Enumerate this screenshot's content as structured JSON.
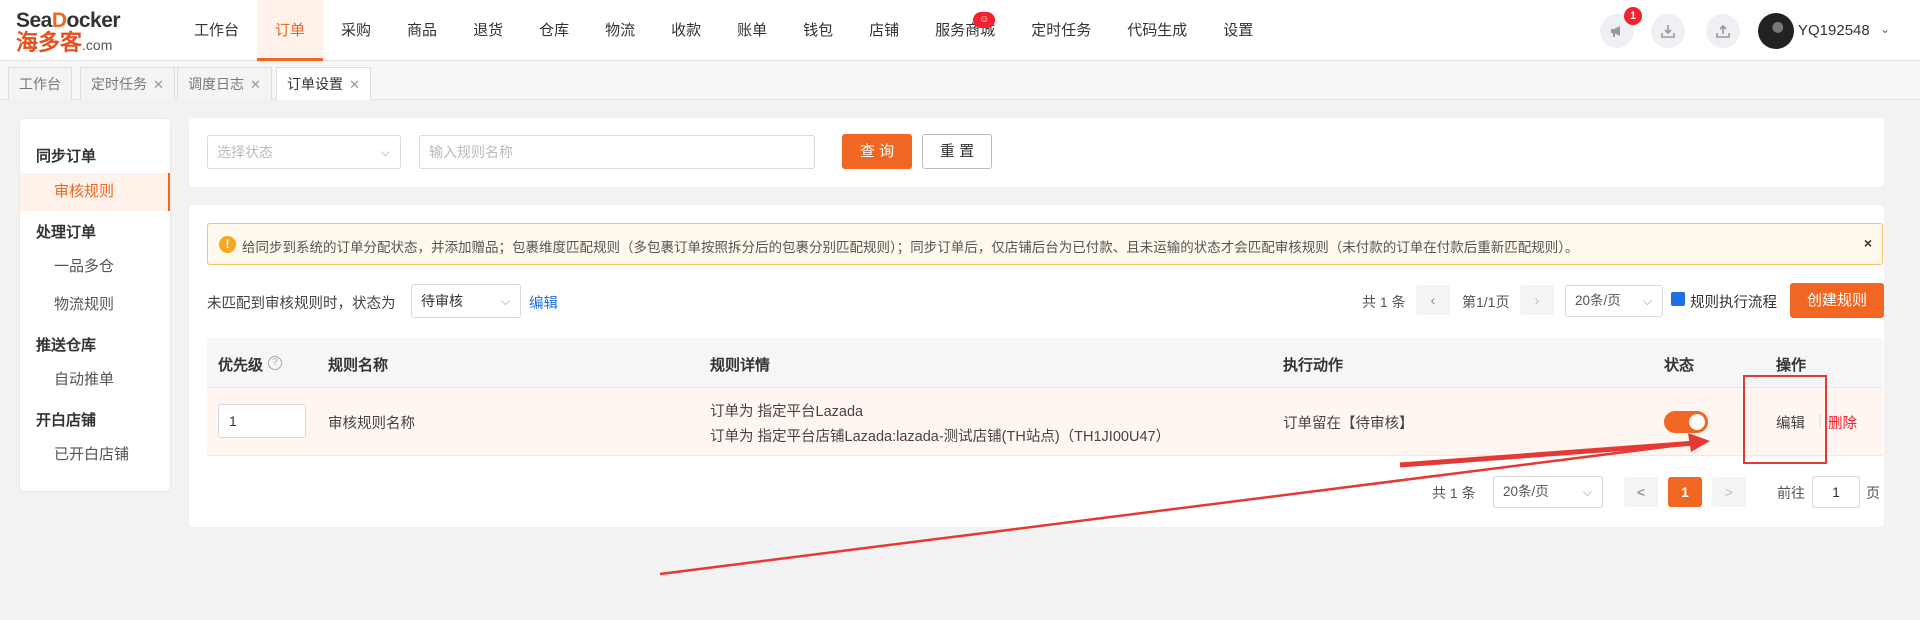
{
  "logo": {
    "line1_a": "Sea",
    "line1_b": "D",
    "line1_c": "ocker",
    "line2": "海多客",
    "line2_suffix": ".com"
  },
  "nav": {
    "items": [
      {
        "label": "工作台"
      },
      {
        "label": "订单",
        "active": true
      },
      {
        "label": "采购"
      },
      {
        "label": "商品"
      },
      {
        "label": "退货"
      },
      {
        "label": "仓库"
      },
      {
        "label": "物流"
      },
      {
        "label": "收款"
      },
      {
        "label": "账单"
      },
      {
        "label": "钱包"
      },
      {
        "label": "店铺"
      },
      {
        "label": "服务商城",
        "badge": "☺"
      },
      {
        "label": "定时任务"
      },
      {
        "label": "代码生成"
      },
      {
        "label": "设置"
      }
    ],
    "notification_count": "1",
    "username": "YQ192548"
  },
  "tabs": [
    {
      "label": "工作台",
      "closable": false
    },
    {
      "label": "定时任务",
      "closable": true
    },
    {
      "label": "调度日志",
      "closable": true
    },
    {
      "label": "订单设置",
      "closable": true,
      "active": true
    }
  ],
  "sidebar": {
    "groups": [
      {
        "title": "同步订单",
        "items": [
          {
            "label": "审核规则",
            "active": true
          }
        ]
      },
      {
        "title": "处理订单",
        "items": [
          {
            "label": "一品多仓"
          },
          {
            "label": "物流规则"
          }
        ]
      },
      {
        "title": "推送仓库",
        "items": [
          {
            "label": "自动推单"
          }
        ]
      },
      {
        "title": "开白店铺",
        "items": [
          {
            "label": "已开白店铺"
          }
        ]
      }
    ]
  },
  "filter": {
    "status_placeholder": "选择状态",
    "name_placeholder": "输入规则名称",
    "query_label": "查 询",
    "reset_label": "重 置"
  },
  "notice": {
    "icon": "!",
    "text": "给同步到系统的订单分配状态，并添加赠品；包裹维度匹配规则（多包裹订单按照拆分后的包裹分别匹配规则）；同步订单后，仅店铺后台为已付款、且未运输的状态才会匹配审核规则（未付款的订单在付款后重新匹配规则）。",
    "close": "×"
  },
  "unmatched": {
    "label": "未匹配到审核规则时，状态为",
    "status_value": "待审核",
    "edit_label": "编辑"
  },
  "top_pager": {
    "total": "共 1 条",
    "page_info": "第1/1页",
    "page_size": "20条/页",
    "flow_label": "规则执行流程",
    "create_label": "创建规则"
  },
  "table": {
    "headers": {
      "priority": "优先级",
      "name": "规则名称",
      "detail": "规则详情",
      "action": "执行动作",
      "status": "状态",
      "ops": "操作"
    },
    "rows": [
      {
        "priority": "1",
        "name": "审核规则名称",
        "detail_line1": "订单为 指定平台Lazada",
        "detail_line2": "订单为 指定平台店铺Lazada:lazada-测试店铺(TH站点)（TH1JI00U47）",
        "action": "订单留在【待审核】",
        "enabled": true,
        "edit_label": "编辑",
        "delete_label": "删除"
      }
    ]
  },
  "bottom_pager": {
    "total": "共 1 条",
    "page_size": "20条/页",
    "prev": "<",
    "current": "1",
    "next": ">",
    "goto_label": "前往",
    "goto_value": "1",
    "page_suffix": "页"
  },
  "colors": {
    "accent": "#f06622",
    "link": "#1e70e6",
    "annotation": "#e53935"
  }
}
